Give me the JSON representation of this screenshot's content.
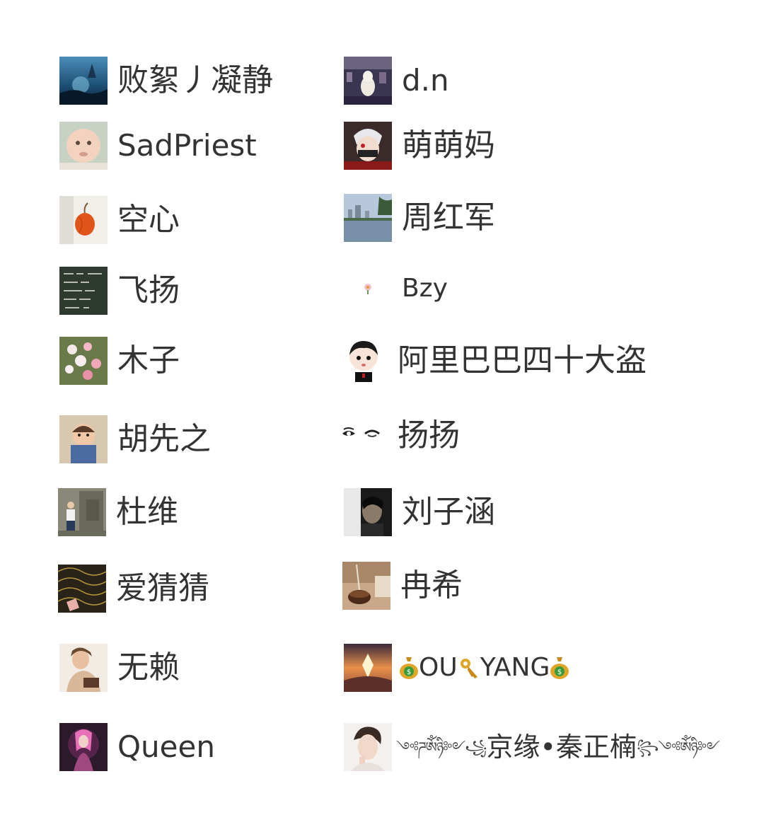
{
  "users": [
    {
      "name": "败絮丿凝静",
      "avatar_icon": "night-landscape-avatar"
    },
    {
      "name": "d.n",
      "avatar_icon": "alpaca-avatar"
    },
    {
      "name": "SadPriest",
      "avatar_icon": "baby-avatar"
    },
    {
      "name": "萌萌妈",
      "avatar_icon": "masked-anime-avatar"
    },
    {
      "name": "空心",
      "avatar_icon": "lantern-plant-avatar"
    },
    {
      "name": "周红军",
      "avatar_icon": "city-lake-avatar"
    },
    {
      "name": "飞扬",
      "avatar_icon": "chalkboard-avatar"
    },
    {
      "name": "Bzy",
      "avatar_icon": "tiny-flower-avatar"
    },
    {
      "name": "木子",
      "avatar_icon": "flowers-avatar"
    },
    {
      "name": "阿里巴巴四十大盗",
      "avatar_icon": "cartoon-boy-avatar"
    },
    {
      "name": "胡先之",
      "avatar_icon": "toddler-avatar"
    },
    {
      "name": "扬扬",
      "avatar_icon": "eyes-avatar"
    },
    {
      "name": "杜维",
      "avatar_icon": "statue-photo-avatar"
    },
    {
      "name": "刘子涵",
      "avatar_icon": "dark-portrait-avatar"
    },
    {
      "name": "爱猜猜",
      "avatar_icon": "gold-pattern-avatar"
    },
    {
      "name": "冉希",
      "avatar_icon": "tea-pour-avatar"
    },
    {
      "name": "无赖",
      "avatar_icon": "woman-portrait-avatar"
    },
    {
      "name_parts": [
        "OU",
        "YANG"
      ],
      "name_icons": [
        "money-bag-icon",
        "key-icon",
        "money-bag-icon"
      ],
      "avatar_icon": "sunset-crystal-avatar"
    },
    {
      "name": "Queen",
      "avatar_icon": "fantasy-pink-avatar"
    },
    {
      "name": "京缘•秦正楠",
      "deco_left": "༺ཌༀཉི༻꧁",
      "deco_right": "꧂༺ༀཉི༻",
      "avatar_icon": "young-man-avatar"
    }
  ],
  "colors": {
    "text": "#333333",
    "background": "#ffffff",
    "coin": "#e0a62a",
    "coin_dark": "#2a7a2a"
  }
}
